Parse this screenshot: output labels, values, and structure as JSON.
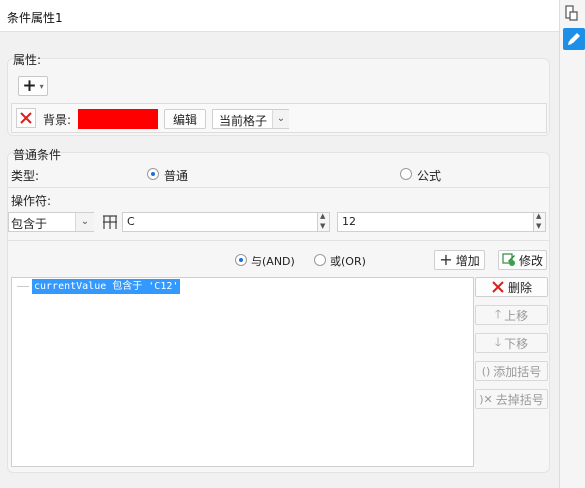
{
  "title": "条件属性1",
  "attributes": {
    "section_label": "属性:",
    "add_icon_symbol": "+",
    "background_label": "背景:",
    "background_color": "#ff0000",
    "edit_button": "编辑",
    "scope_select_value": "当前格子"
  },
  "condition": {
    "section_label": "普通条件",
    "type_label": "类型:",
    "type_options": [
      {
        "label": "普通",
        "selected": true
      },
      {
        "label": "公式",
        "selected": false
      }
    ],
    "operator_label": "操作符:",
    "operator_value": "包含于",
    "field_value": "C",
    "value_input": "12",
    "logic_options": [
      {
        "label": "与(AND)",
        "selected": true
      },
      {
        "label": "或(OR)",
        "selected": false
      }
    ],
    "add_button": "增加",
    "modify_button": "修改"
  },
  "condition_list": {
    "items": [
      "currentValue 包含于 'C12'"
    ]
  },
  "side_actions": {
    "delete": "删除",
    "move_up": "上移",
    "move_down": "下移",
    "add_bracket": "添加括号",
    "remove_bracket": "去掉括号"
  },
  "colors": {
    "accent": "#1e6fd9",
    "selection": "#3399ff",
    "delete_red": "#d9201c"
  }
}
